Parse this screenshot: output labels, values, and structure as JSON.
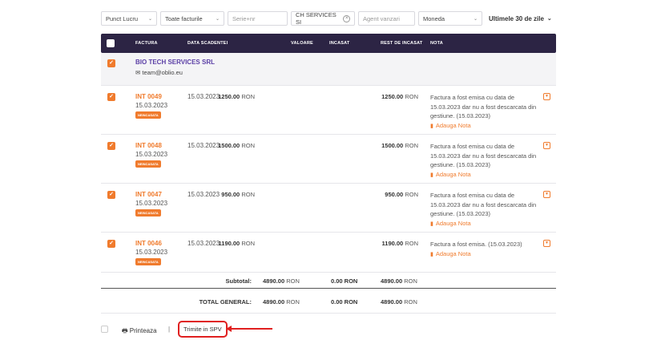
{
  "filters": {
    "punct_lucru": "Punct Lucru",
    "tip_factura": "Toate facturile",
    "serie_placeholder": "Serie+nr",
    "client": "CH SERVICES SI",
    "agent_placeholder": "Agent vanzari",
    "moneda": "Moneda",
    "perioada": "Ultimele 30 de zile"
  },
  "table": {
    "headers": [
      "FACTURA",
      "DATA SCADENTEI",
      "VALOARE",
      "INCASAT",
      "REST DE INCASAT",
      "NOTA"
    ]
  },
  "customer": {
    "name": "BIO TECH SERVICES SRL",
    "email": "team@oblio.eu"
  },
  "invoices": [
    {
      "number": "INT 0049",
      "date": "15.03.2023",
      "status": "NEINCASATA",
      "due": "15.03.2023",
      "value": "1250.00",
      "currency": "RON",
      "rest": "1250.00",
      "note": "Factura a fost emisa cu data de 15.03.2023 dar nu a fost descarcata din gestiune. (15.03.2023)",
      "add_note": "Adauga Nota"
    },
    {
      "number": "INT 0048",
      "date": "15.03.2023",
      "status": "NEINCASATA",
      "due": "15.03.2023",
      "value": "1500.00",
      "currency": "RON",
      "rest": "1500.00",
      "note": "Factura a fost emisa cu data de 15.03.2023 dar nu a fost descarcata din gestiune. (15.03.2023)",
      "add_note": "Adauga Nota"
    },
    {
      "number": "INT 0047",
      "date": "15.03.2023",
      "status": "NEINCASATA",
      "due": "15.03.2023",
      "value": "950.00",
      "currency": "RON",
      "rest": "950.00",
      "note": "Factura a fost emisa cu data de 15.03.2023 dar nu a fost descarcata din gestiune. (15.03.2023)",
      "add_note": "Adauga Nota"
    },
    {
      "number": "INT 0046",
      "date": "15.03.2023",
      "status": "NEINCASATA",
      "due": "15.03.2023",
      "value": "1190.00",
      "currency": "RON",
      "rest": "1190.00",
      "note": "Factura a fost emisa. (15.03.2023)",
      "add_note": "Adauga Nota"
    }
  ],
  "subtotal": {
    "label": "Subtotal:",
    "value": "4890.00",
    "incasat": "0.00 RON",
    "rest": "4890.00",
    "currency": "RON"
  },
  "total": {
    "label": "TOTAL GENERAL:",
    "value": "4890.00",
    "incasat": "0.00 RON",
    "rest": "4890.00",
    "currency": "RON"
  },
  "footer": {
    "print": "Printeaza",
    "separator": "|",
    "spv": "Trimite in SPV"
  },
  "colors": {
    "accent": "#f07b2d",
    "header": "#2c2444",
    "customer": "#5b3fa6",
    "highlight": "#e02020"
  }
}
